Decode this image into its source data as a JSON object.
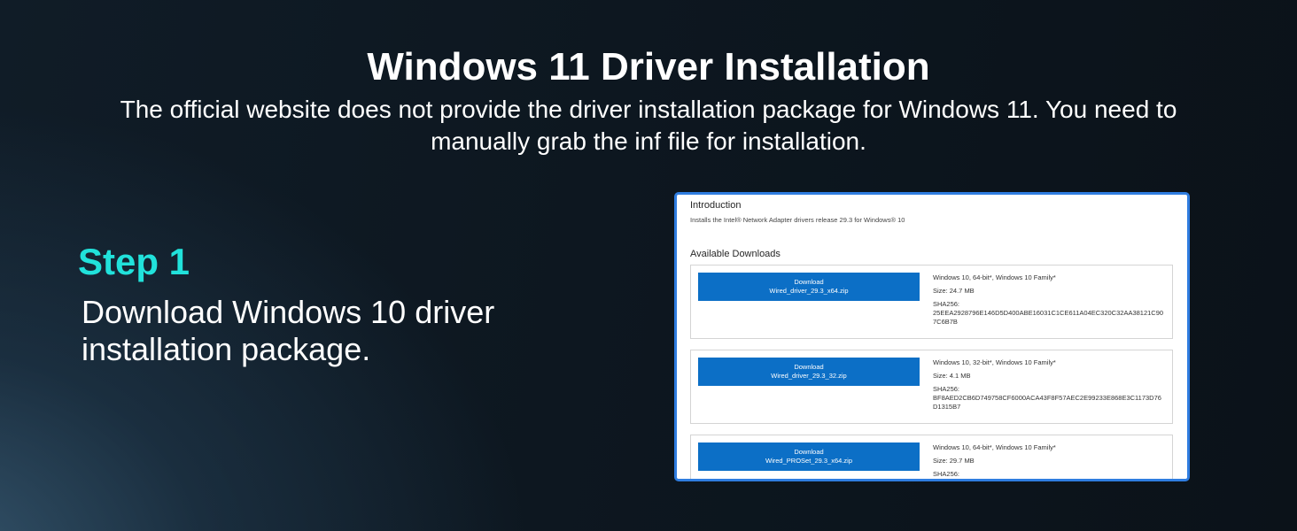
{
  "header": {
    "title": "Windows 11 Driver Installation",
    "subtitle": "The official website does not provide the driver installation package for Windows 11. You need to manually grab the inf file for installation."
  },
  "step": {
    "title": "Step 1",
    "description": "Download Windows 10 driver installation package."
  },
  "screenshot": {
    "intro_heading": "Introduction",
    "intro_text": "Installs the Intel® Network Adapter drivers release 29.3 for Windows® 10",
    "downloads_heading": "Available Downloads",
    "downloads": [
      {
        "button_top": "Download",
        "file": "Wired_driver_29.3_x64.zip",
        "os": "Windows 10, 64-bit*, Windows 10 Family*",
        "size": "Size: 24.7 MB",
        "sha_label": "SHA256:",
        "sha": "25EEA2928796E146D5D400ABE16031C1CE611A04EC320C32AA38121C907C6B7B"
      },
      {
        "button_top": "Download",
        "file": "Wired_driver_29.3_32.zip",
        "os": "Windows 10, 32-bit*, Windows 10 Family*",
        "size": "Size: 4.1 MB",
        "sha_label": "SHA256:",
        "sha": "BF8AED2CB6D749758CF6000ACA43F8F57AEC2E99233E868E3C1173D76D1315B7"
      },
      {
        "button_top": "Download",
        "file": "Wired_PROSet_29.3_x64.zip",
        "os": "Windows 10, 64-bit*, Windows 10 Family*",
        "size": "Size: 29.7 MB",
        "sha_label": "SHA256:"
      }
    ]
  },
  "colors": {
    "accent_step": "#21e2db",
    "download_button": "#0c6fc6",
    "screenshot_border": "#2f7de0"
  }
}
